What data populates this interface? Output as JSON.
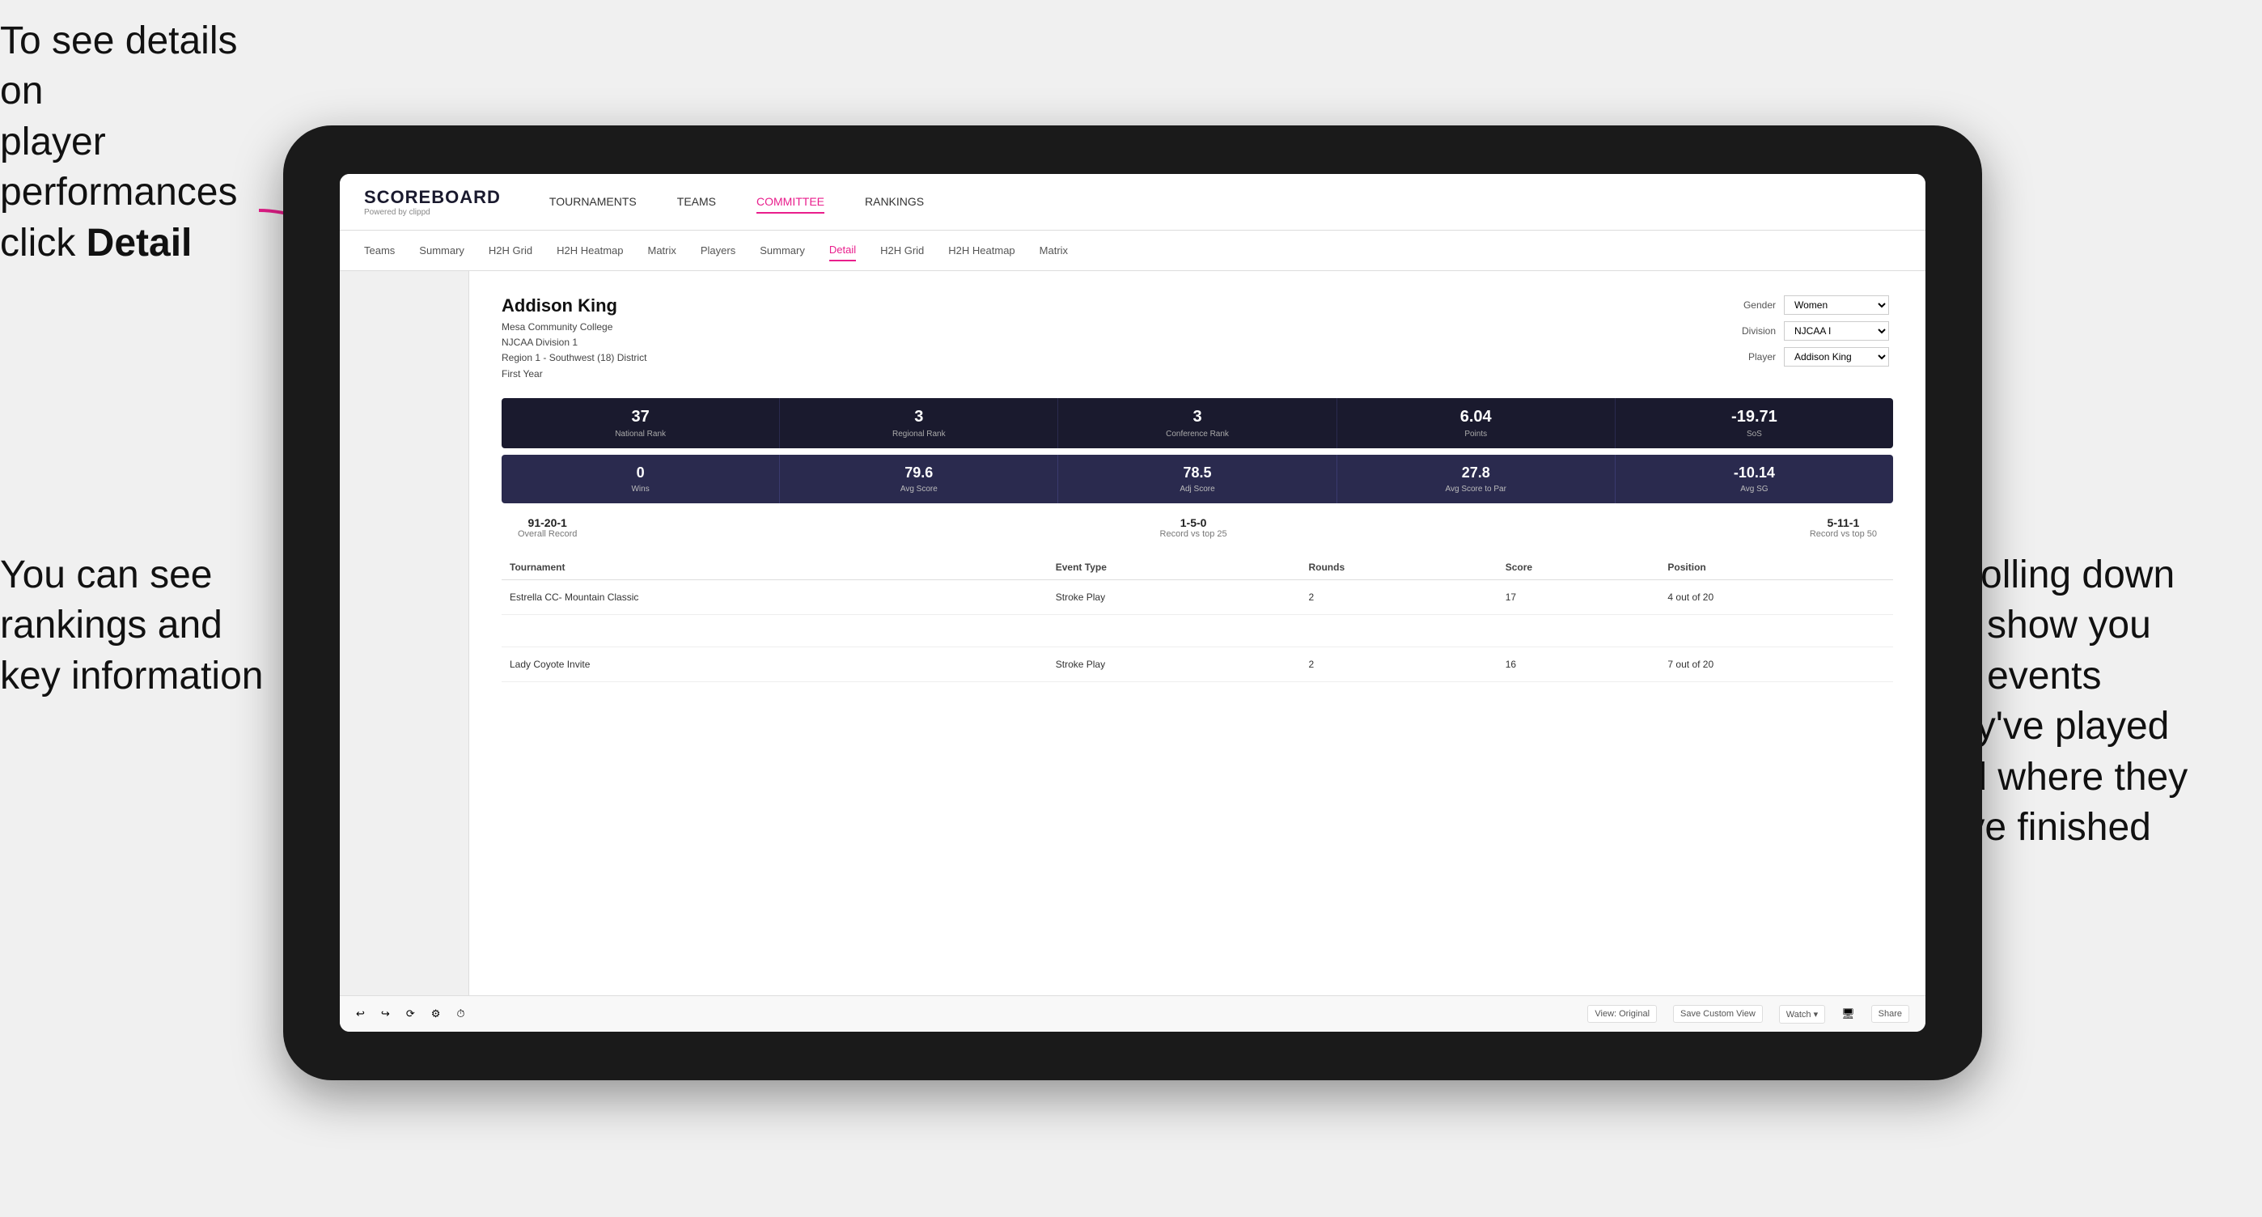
{
  "annotations": {
    "top_left": {
      "line1": "To see details on",
      "line2": "player performances",
      "line3_prefix": "click ",
      "line3_bold": "Detail"
    },
    "bottom_left": {
      "line1": "You can see",
      "line2": "rankings and",
      "line3": "key information"
    },
    "right": {
      "line1": "Scrolling down",
      "line2": "will show you",
      "line3": "the events",
      "line4": "they've played",
      "line5": "and where they",
      "line6": "have finished"
    }
  },
  "nav": {
    "logo": "SCOREBOARD",
    "logo_sub": "Powered by clippd",
    "links": [
      "TOURNAMENTS",
      "TEAMS",
      "COMMITTEE",
      "RANKINGS"
    ],
    "active_link": "COMMITTEE"
  },
  "sub_nav": {
    "items": [
      "Teams",
      "Summary",
      "H2H Grid",
      "H2H Heatmap",
      "Matrix",
      "Players",
      "Summary",
      "Detail",
      "H2H Grid",
      "H2H Heatmap",
      "Matrix"
    ],
    "active_item": "Detail"
  },
  "player": {
    "name": "Addison King",
    "college": "Mesa Community College",
    "division": "NJCAA Division 1",
    "region": "Region 1 - Southwest (18) District",
    "year": "First Year",
    "filters": {
      "gender_label": "Gender",
      "gender_value": "Women",
      "division_label": "Division",
      "division_value": "NJCAA I",
      "player_label": "Player",
      "player_value": "Addison King"
    }
  },
  "stats_row1": [
    {
      "value": "37",
      "label": "National Rank"
    },
    {
      "value": "3",
      "label": "Regional Rank"
    },
    {
      "value": "3",
      "label": "Conference Rank"
    },
    {
      "value": "6.04",
      "label": "Points"
    },
    {
      "value": "-19.71",
      "label": "SoS"
    }
  ],
  "stats_row2": [
    {
      "value": "0",
      "label": "Wins"
    },
    {
      "value": "79.6",
      "label": "Avg Score"
    },
    {
      "value": "78.5",
      "label": "Adj Score"
    },
    {
      "value": "27.8",
      "label": "Avg Score to Par"
    },
    {
      "value": "-10.14",
      "label": "Avg SG"
    }
  ],
  "records": [
    {
      "value": "91-20-1",
      "label": "Overall Record"
    },
    {
      "value": "1-5-0",
      "label": "Record vs top 25"
    },
    {
      "value": "5-11-1",
      "label": "Record vs top 50"
    }
  ],
  "table": {
    "headers": [
      "Tournament",
      "Event Type",
      "Rounds",
      "Score",
      "Position"
    ],
    "rows": [
      {
        "tournament": "Estrella CC- Mountain Classic",
        "event_type": "Stroke Play",
        "rounds": "2",
        "score": "17",
        "position": "4 out of 20"
      },
      {
        "tournament": "",
        "event_type": "",
        "rounds": "",
        "score": "",
        "position": ""
      },
      {
        "tournament": "Lady Coyote Invite",
        "event_type": "Stroke Play",
        "rounds": "2",
        "score": "16",
        "position": "7 out of 20"
      }
    ]
  },
  "toolbar": {
    "buttons": [
      "View: Original",
      "Save Custom View",
      "Watch ▾",
      "Share"
    ]
  }
}
